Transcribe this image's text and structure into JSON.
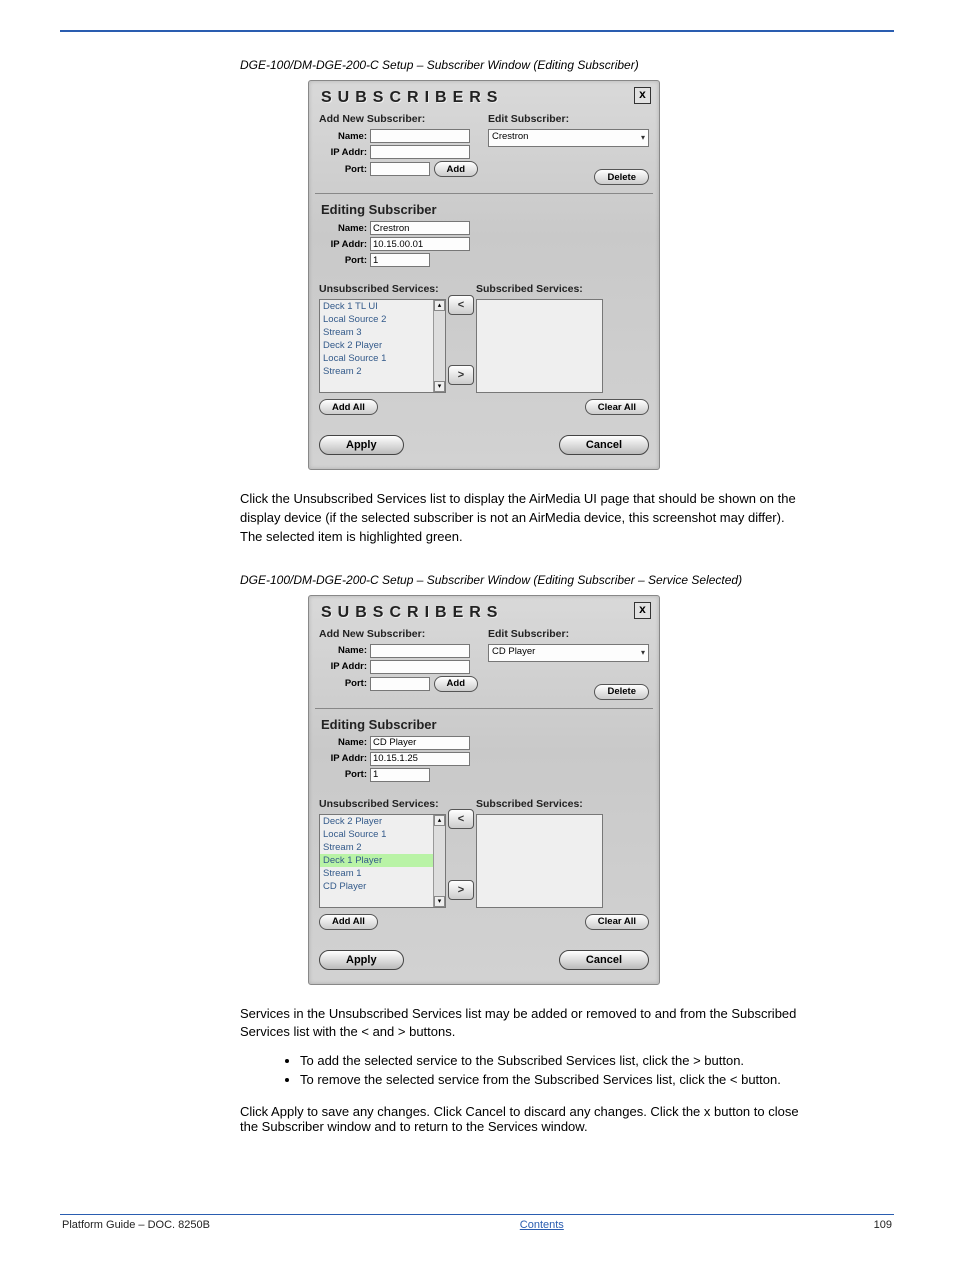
{
  "header": {
    "left": "Platform Guide – DOC. 8250B",
    "mid": "Contents",
    "right": "109"
  },
  "fig1": {
    "caption": "DGE-100/DM-DGE-200-C Setup – Subscriber Window (Editing Subscriber)"
  },
  "fig2": {
    "caption": "DGE-100/DM-DGE-200-C Setup – Subscriber Window (Editing Subscriber – Service Selected)"
  },
  "para1": "Click the Unsubscribed Services list to display the AirMedia UI page that should be shown on the display device (if the selected subscriber is not an AirMedia device, this screenshot may differ). The selected item is highlighted green.",
  "para2": "Services in the Unsubscribed Services list may be added or removed to and from the Subscribed Services list with the < and > buttons.",
  "bullets": [
    "To add the selected service to the Subscribed Services list, click the > button.",
    "To remove the selected service from the Subscribed Services list, click the < button."
  ],
  "aftertext": "Click Apply to save any changes. Click Cancel to discard any changes. Click the x button to close the Subscriber window and to return to the Services window.",
  "dialog1": {
    "title": "SUBSCRIBERS",
    "addHdr": "Add New Subscriber:",
    "editHdr": "Edit Subscriber:",
    "labels": {
      "name": "Name:",
      "ip": "IP Addr:",
      "port": "Port:"
    },
    "addBtn": "Add",
    "deleteBtn": "Delete",
    "selValue": "Crestron",
    "editSection": "Editing Subscriber",
    "editVals": {
      "name": "Crestron",
      "ip": "10.15.00.01",
      "port": "1"
    },
    "unsubHdr": "Unsubscribed Services:",
    "subHdr": "Subscribed Services:",
    "unsubItems": [
      "Deck 1 TL UI",
      "Local Source 2",
      "Stream 3",
      "Deck 2 Player",
      "Local Source 1",
      "Stream 2"
    ],
    "highlight": -1,
    "addAll": "Add All",
    "clearAll": "Clear All",
    "apply": "Apply",
    "cancel": "Cancel"
  },
  "dialog2": {
    "title": "SUBSCRIBERS",
    "addHdr": "Add New Subscriber:",
    "editHdr": "Edit Subscriber:",
    "labels": {
      "name": "Name:",
      "ip": "IP Addr:",
      "port": "Port:"
    },
    "addBtn": "Add",
    "deleteBtn": "Delete",
    "selValue": "CD Player",
    "editSection": "Editing Subscriber",
    "editVals": {
      "name": "CD Player",
      "ip": "10.15.1.25",
      "port": "1"
    },
    "unsubHdr": "Unsubscribed Services:",
    "subHdr": "Subscribed Services:",
    "unsubItems": [
      "Deck 2 Player",
      "Local Source 1",
      "Stream 2",
      "Deck 1 Player",
      "Stream 1",
      "CD Player"
    ],
    "highlight": 3,
    "addAll": "Add All",
    "clearAll": "Clear All",
    "apply": "Apply",
    "cancel": "Cancel"
  }
}
